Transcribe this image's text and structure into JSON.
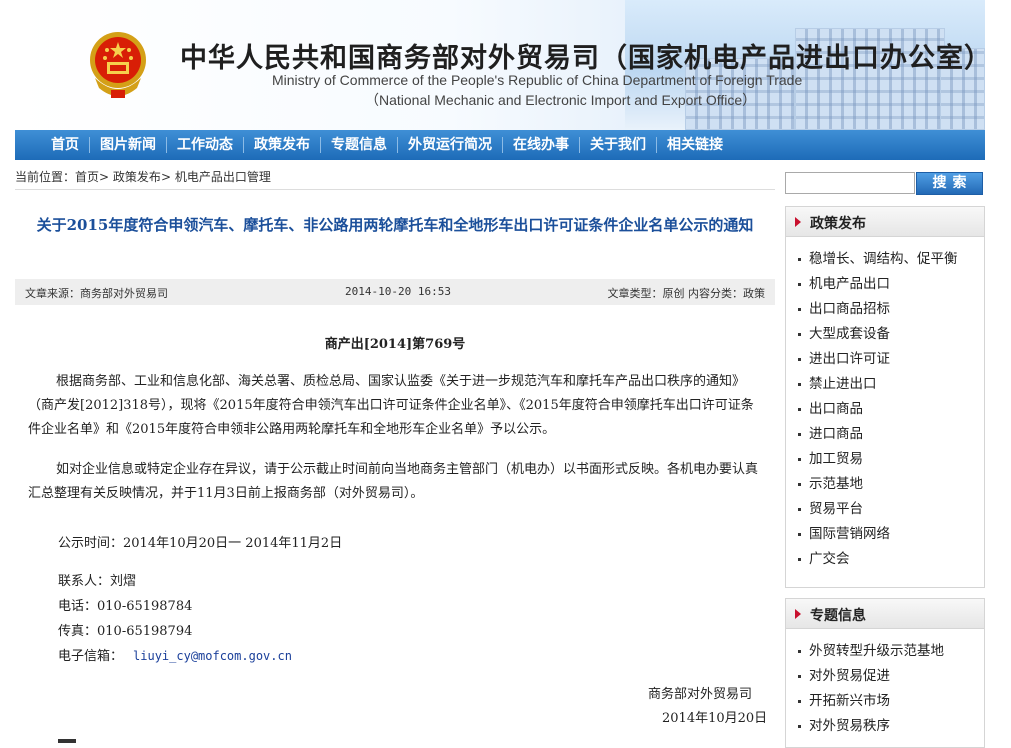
{
  "header": {
    "title_cn": "中华人民共和国商务部对外贸易司（国家机电产品进出口办公室）",
    "title_en_line1": "Ministry of Commerce of the People's Republic of China Department of Foreign Trade",
    "title_en_line2": "（National Mechanic and Electronic Import and Export Office）"
  },
  "nav": {
    "items": [
      "首页",
      "图片新闻",
      "工作动态",
      "政策发布",
      "专题信息",
      "外贸运行简况",
      "在线办事",
      "关于我们",
      "相关链接"
    ]
  },
  "breadcrumb": {
    "label": "当前位置：",
    "items": [
      "首页",
      "政策发布",
      "机电产品出口管理"
    ],
    "separator": ">"
  },
  "article": {
    "title": "关于2015年度符合申领汽车、摩托车、非公路用两轮摩托车和全地形车出口许可证条件企业名单公示的通知",
    "meta": {
      "source": "文章来源：商务部对外贸易司",
      "date": "2014-10-20 16:53",
      "type": "文章类型：原创  内容分类：政策"
    },
    "doc_number": "商产出[2014]第769号",
    "paragraphs": [
      "根据商务部、工业和信息化部、海关总署、质检总局、国家认监委《关于进一步规范汽车和摩托车产品出口秩序的通知》（商产发[2012]318号），现将《2015年度符合申领汽车出口许可证条件企业名单》、《2015年度符合申领摩托车出口许可证条件企业名单》和《2015年度符合申领非公路用两轮摩托车和全地形车企业名单》予以公示。",
      "如对企业信息或特定企业存在异议，请于公示截止时间前向当地商务主管部门（机电办）以书面形式反映。各机电办要认真汇总整理有关反映情况，并于11月3日前上报商务部（对外贸易司）。"
    ],
    "publication_time": "公示时间：2014年10月20日一 2014年11月2日",
    "contact": "联系人：刘熠",
    "phone": "电话：010-65198784",
    "fax": "传真：010-65198794",
    "email_label": "电子信箱：",
    "email": "liuyi_cy@mofcom.gov.cn",
    "signature_org": "商务部对外贸易司",
    "signature_date": "2014年10月20日"
  },
  "sidebar": {
    "search_placeholder": "",
    "search_button": "搜索",
    "policy": {
      "title": "政策发布",
      "items": [
        "稳增长、调结构、促平衡",
        "机电产品出口",
        "出口商品招标",
        "大型成套设备",
        "进出口许可证",
        "禁止进出口",
        "出口商品",
        "进口商品",
        "加工贸易",
        "示范基地",
        "贸易平台",
        "国际营销网络",
        "广交会"
      ]
    },
    "topics": {
      "title": "专题信息",
      "items": [
        "外贸转型升级示范基地",
        "对外贸易促进",
        "开拓新兴市场",
        "对外贸易秩序"
      ]
    }
  },
  "colors": {
    "nav": "#1d6bb8",
    "title": "#1b4f9a",
    "accent_arrow": "#c8102e",
    "link": "#1a3f9a"
  }
}
